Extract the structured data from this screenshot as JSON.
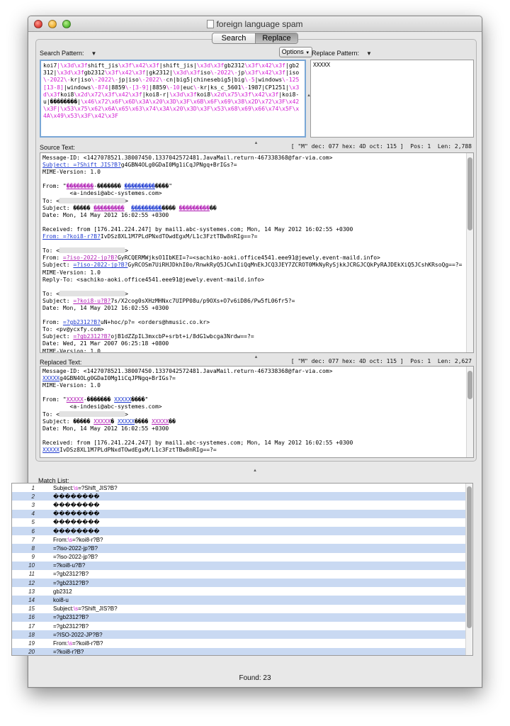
{
  "window": {
    "title": "foreign language spam"
  },
  "tabs": [
    {
      "label": "Search",
      "active": false
    },
    {
      "label": "Replace",
      "active": true
    }
  ],
  "search": {
    "label": "Search Pattern:",
    "options_label": "Options",
    "pattern_segments": [
      {
        "t": "koi7",
        "e": false
      },
      {
        "t": "|\\x3d\\x3f",
        "e": true
      },
      {
        "t": "shift_jis",
        "e": false
      },
      {
        "t": "\\x3f\\x42\\x3f",
        "e": true
      },
      {
        "t": "|shift_jis|",
        "e": false
      },
      {
        "t": "\\x3d\\x3f",
        "e": true
      },
      {
        "t": "gb2312",
        "e": false
      },
      {
        "t": "\\x3f\\x42\\x3f",
        "e": true
      },
      {
        "t": "|gb2312|",
        "e": false
      },
      {
        "t": "\\x3d\\x3f",
        "e": true
      },
      {
        "t": "gb2312",
        "e": false
      },
      {
        "t": "\\x3f\\x42\\x3f",
        "e": true
      },
      {
        "t": "|gk2312|",
        "e": false
      },
      {
        "t": "\\x3d\\x3f",
        "e": true
      },
      {
        "t": "iso",
        "e": false
      },
      {
        "t": "\\-2022\\-",
        "e": true
      },
      {
        "t": "jp",
        "e": false
      },
      {
        "t": "\\x3f\\x42\\x3f",
        "e": true
      },
      {
        "t": "|iso",
        "e": false
      },
      {
        "t": "\\-2022\\-",
        "e": true
      },
      {
        "t": "kr|iso",
        "e": false
      },
      {
        "t": "\\-2022\\-",
        "e": true
      },
      {
        "t": "jp|iso",
        "e": false
      },
      {
        "t": "\\-2022\\-",
        "e": true
      },
      {
        "t": "cn|big5|chinesebig5|big",
        "e": false
      },
      {
        "t": "\\-5",
        "e": true
      },
      {
        "t": "|windows",
        "e": false
      },
      {
        "t": "\\-125[13-8]",
        "e": true
      },
      {
        "t": "|windows",
        "e": false
      },
      {
        "t": "\\-874",
        "e": true
      },
      {
        "t": "|8859",
        "e": false
      },
      {
        "t": "\\-[3-9]",
        "e": true
      },
      {
        "t": "|8859",
        "e": false
      },
      {
        "t": "\\-10",
        "e": true
      },
      {
        "t": "|euc",
        "e": false
      },
      {
        "t": "\\-",
        "e": true
      },
      {
        "t": "kr|ks_c_5601",
        "e": false
      },
      {
        "t": "\\-",
        "e": true
      },
      {
        "t": "1987|CP1251|",
        "e": false
      },
      {
        "t": "\\x3d\\x3f",
        "e": true
      },
      {
        "t": "koi8",
        "e": false
      },
      {
        "t": "\\x2d\\x72\\x3f\\x42\\x3f",
        "e": true
      },
      {
        "t": "|koi8-r|",
        "e": false
      },
      {
        "t": "\\x3d\\x3f",
        "e": true
      },
      {
        "t": "koi8",
        "e": false
      },
      {
        "t": "\\x2d\\x75\\x3f\\x42\\x3f",
        "e": true
      },
      {
        "t": "|koi8-u|��������|",
        "e": false
      },
      {
        "t": "\\x46\\x72\\x6F\\x6D\\x3A\\x20\\x3D\\x3F\\x6B\\x6F\\x69\\x38\\x2D\\x72\\x3F\\x42\\x3F|\\x53\\x75\\x62\\x6A\\x65\\x63\\x74\\x3A\\x20\\x3D\\x3F\\x53\\x68\\x69\\x66\\x74\\x5F\\x4A\\x49\\x53\\x3F\\x42\\x3F",
        "e": true
      }
    ]
  },
  "replace": {
    "label": "Replace Pattern:",
    "value": "XXXXX"
  },
  "source": {
    "label": "Source Text:",
    "stats": "[ \"M\" dec: 077 hex: 4D oct: 115 ]  Pos: 1  Len: 2,788",
    "lines": [
      [
        {
          "t": "Message-ID: <1427078521.38007450.1337042572481.JavaMail.return-467338368@far-via.com>"
        }
      ],
      [
        {
          "t": "Subject: =?Shift_JIS?B?",
          "c": "lnk"
        },
        {
          "t": "g4GBN4OLg0GDaI0Mg1iCqJPNgq+BrIGs?="
        }
      ],
      [
        {
          "t": "MIME-Version: 1.0"
        }
      ],
      [
        {
          "t": ""
        }
      ],
      [
        {
          "t": "From: \""
        },
        {
          "t": "��������",
          "c": "mag"
        },
        {
          "t": "-������� "
        },
        {
          "t": "���������",
          "c": "blu"
        },
        {
          "t": "����\""
        }
      ],
      [
        {
          "t": "        <a-indesi@abc-systemes.com>"
        }
      ],
      [
        {
          "t": "To: <"
        },
        {
          "t": "",
          "c": "blur"
        },
        {
          "t": ">"
        }
      ],
      [
        {
          "t": "Subject: ����� "
        },
        {
          "t": "���������",
          "c": "mag"
        },
        {
          "t": "  "
        },
        {
          "t": "���������",
          "c": "blu"
        },
        {
          "t": "���� "
        },
        {
          "t": "���������",
          "c": "mag"
        },
        {
          "t": "��"
        }
      ],
      [
        {
          "t": "Date: Mon, 14 May 2012 16:02:55 +0300"
        }
      ],
      [
        {
          "t": ""
        }
      ],
      [
        {
          "t": "Received: from [176.241.224.247] by mail1.abc-systemes.com; Mon, 14 May 2012 16:02:55 +0300"
        }
      ],
      [
        {
          "t": "From: =?koi8-r?B?",
          "c": "lnk"
        },
        {
          "t": "IvDSz8XL1M7PLdPNxdTOwdEgxM/L1c3FztTBw8nRIg==?="
        }
      ],
      [
        {
          "t": ""
        }
      ],
      [
        {
          "t": "To: <"
        },
        {
          "t": "",
          "c": "blur"
        },
        {
          "t": ">"
        }
      ],
      [
        {
          "t": "From: "
        },
        {
          "t": "=?iso-2022-jp?B?",
          "c": "mag"
        },
        {
          "t": "GyRCQERMWjksO1IbKEI=?=<sachiko-aoki.office4541.eee91@jewely.event-maild.info>"
        }
      ],
      [
        {
          "t": "Subject: "
        },
        {
          "t": "=?iso-2022-jp?B?",
          "c": "blu"
        },
        {
          "t": "GyRCOSm7UiRHJDkhI0o/RnwkRyQ5JCwhIiQqMnEkJCQ3JEY7ZCROT0MkNyRySjkkJCRGJCQkPyRAJDEkXiQ5JCshKRsoQg==?="
        }
      ],
      [
        {
          "t": "MIME-Version: 1.0"
        }
      ],
      [
        {
          "t": "Reply-To: <sachiko-aoki.office4541.eee91@jewely.event-maild.info>"
        }
      ],
      [
        {
          "t": ""
        }
      ],
      [
        {
          "t": "To: <"
        },
        {
          "t": "",
          "c": "blur"
        },
        {
          "t": ">"
        }
      ],
      [
        {
          "t": "Subject: "
        },
        {
          "t": "=?koi8-u?B?",
          "c": "mag"
        },
        {
          "t": "7s/X2cog0sXHzMHNxc7UIPP08u/p9OXs+O7v6iD86/Pw5fL06fr5?="
        }
      ],
      [
        {
          "t": "Date: Mon, 14 May 2012 16:02:55 +0300"
        }
      ],
      [
        {
          "t": ""
        }
      ],
      [
        {
          "t": "From: "
        },
        {
          "t": "=?gb2312?B?",
          "c": "blu"
        },
        {
          "t": "uN+hoc/p?= <orders@hmusic.co.kr>"
        }
      ],
      [
        {
          "t": "To: <pv@ycxfy.com>"
        }
      ],
      [
        {
          "t": "Subject: "
        },
        {
          "t": "=?gb2312?B?",
          "c": "mag"
        },
        {
          "t": "ojB1dZZpIL3mxcbP+srbt+i/8dG1wbcga3Nrdw==?="
        }
      ],
      [
        {
          "t": "Date: Wed, 21 Mar 2007 06:25:18 +0800"
        }
      ],
      [
        {
          "t": "MIME-Version: 1.0"
        }
      ]
    ]
  },
  "replaced": {
    "label": "Replaced Text:",
    "stats": "[ \"M\" dec: 077 hex: 4D oct: 115 ]  Pos: 1  Len: 2,627",
    "lines": [
      [
        {
          "t": "Message-ID: <1427078521.38007450.1337042572481.JavaMail.return-467338368@far-via.com>"
        }
      ],
      [
        {
          "t": "XXXXX",
          "c": "lnk"
        },
        {
          "t": "g4GBN4OLg0GDaI0Mg1iCqJPNgq+BrIGs?="
        }
      ],
      [
        {
          "t": "MIME-Version: 1.0"
        }
      ],
      [
        {
          "t": ""
        }
      ],
      [
        {
          "t": "From: \""
        },
        {
          "t": "XXXXX",
          "c": "mag"
        },
        {
          "t": "-������� "
        },
        {
          "t": "XXXXX",
          "c": "blu"
        },
        {
          "t": "����\""
        }
      ],
      [
        {
          "t": "        <a-indesi@abc-systemes.com>"
        }
      ],
      [
        {
          "t": "To: <"
        },
        {
          "t": "",
          "c": "blur"
        },
        {
          "t": ">"
        }
      ],
      [
        {
          "t": "Subject: ����� "
        },
        {
          "t": "XXXXX",
          "c": "mag"
        },
        {
          "t": "� "
        },
        {
          "t": "XXXXX",
          "c": "blu"
        },
        {
          "t": "���� "
        },
        {
          "t": "XXXXX",
          "c": "mag"
        },
        {
          "t": "��"
        }
      ],
      [
        {
          "t": "Date: Mon, 14 May 2012 16:02:55 +0300"
        }
      ],
      [
        {
          "t": ""
        }
      ],
      [
        {
          "t": "Received: from [176.241.224.247] by mail1.abc-systemes.com; Mon, 14 May 2012 16:02:55 +0300"
        }
      ],
      [
        {
          "t": "XXXXX",
          "c": "lnk"
        },
        {
          "t": "IvDSz8XL1M7PLdPNxdTOwdEgxM/L1c3FztTBw8nRIg==?="
        }
      ]
    ]
  },
  "matchlist": {
    "label": "Match List:",
    "rows": [
      {
        "n": "1",
        "s": [
          {
            "t": "Subject:"
          },
          {
            "t": "\\s",
            "e": true
          },
          {
            "t": "=?Shift_JIS?B?"
          }
        ]
      },
      {
        "n": "2",
        "s": [
          {
            "t": "��������"
          }
        ]
      },
      {
        "n": "3",
        "s": [
          {
            "t": "��������"
          }
        ]
      },
      {
        "n": "4",
        "s": [
          {
            "t": "��������"
          }
        ]
      },
      {
        "n": "5",
        "s": [
          {
            "t": "��������"
          }
        ]
      },
      {
        "n": "6",
        "s": [
          {
            "t": "��������"
          }
        ]
      },
      {
        "n": "7",
        "s": [
          {
            "t": "From:"
          },
          {
            "t": "\\s",
            "e": true
          },
          {
            "t": "=?koi8-r?B?"
          }
        ]
      },
      {
        "n": "8",
        "s": [
          {
            "t": "=?iso-2022-jp?B?"
          }
        ]
      },
      {
        "n": "9",
        "s": [
          {
            "t": "=?iso-2022-jp?B?"
          }
        ]
      },
      {
        "n": "10",
        "s": [
          {
            "t": "=?koi8-u?B?"
          }
        ]
      },
      {
        "n": "11",
        "s": [
          {
            "t": "=?gb2312?B?"
          }
        ]
      },
      {
        "n": "12",
        "s": [
          {
            "t": "=?gb2312?B?"
          }
        ]
      },
      {
        "n": "13",
        "s": [
          {
            "t": "gb2312"
          }
        ]
      },
      {
        "n": "14",
        "s": [
          {
            "t": "koi8-u"
          }
        ]
      },
      {
        "n": "15",
        "s": [
          {
            "t": "Subject:"
          },
          {
            "t": "\\s",
            "e": true
          },
          {
            "t": "=?Shift_JIS?B?"
          }
        ]
      },
      {
        "n": "16",
        "s": [
          {
            "t": "=?gb2312?B?"
          }
        ]
      },
      {
        "n": "17",
        "s": [
          {
            "t": "=?gb2312?B?"
          }
        ]
      },
      {
        "n": "18",
        "s": [
          {
            "t": "=?ISO-2022-JP?B?"
          }
        ]
      },
      {
        "n": "19",
        "s": [
          {
            "t": "From:"
          },
          {
            "t": "\\s",
            "e": true
          },
          {
            "t": "=?koi8-r?B?"
          }
        ]
      },
      {
        "n": "20",
        "s": [
          {
            "t": "=?koi8-r?B?"
          }
        ]
      }
    ]
  },
  "found": "Found: 23"
}
